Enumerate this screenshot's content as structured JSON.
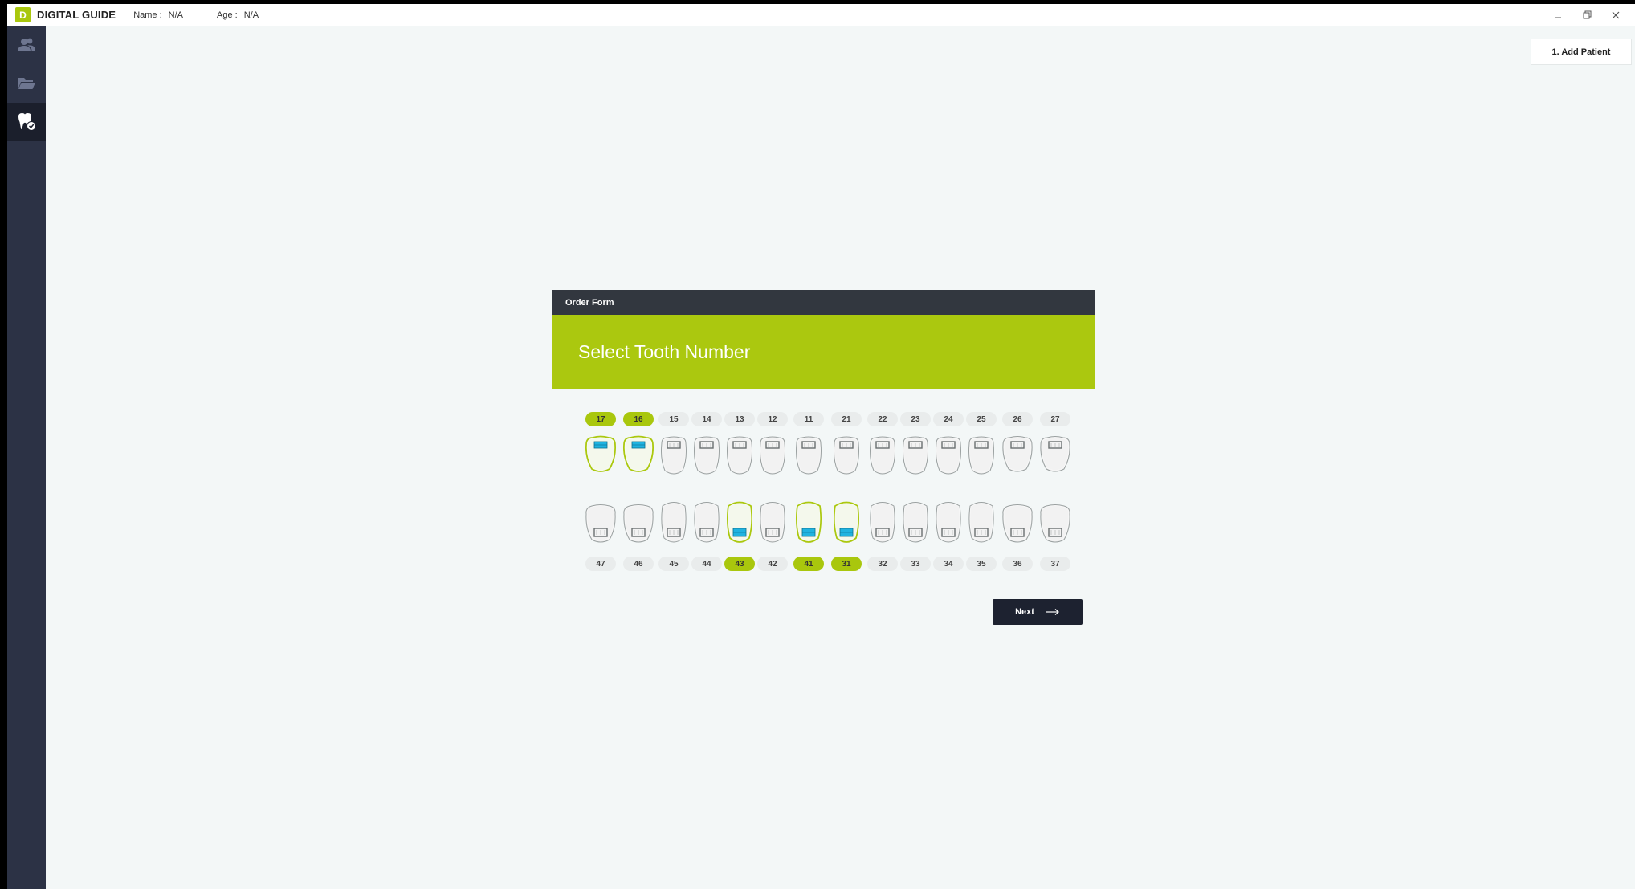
{
  "app": {
    "logo_letter": "D",
    "title": "DIGITAL GUIDE",
    "name_label": "Name :",
    "name_value": "N/A",
    "age_label": "Age :",
    "age_value": "N/A"
  },
  "window_controls": [
    "minimize-icon",
    "restore-icon",
    "close-icon"
  ],
  "sidebar": {
    "items": [
      {
        "icon": "patients-icon",
        "active": false
      },
      {
        "icon": "folder-icon",
        "active": false
      },
      {
        "icon": "tooth-check-icon",
        "active": true
      }
    ]
  },
  "step_button": {
    "label": "1. Add Patient"
  },
  "order_form": {
    "header": "Order Form",
    "title": "Select Tooth Number",
    "next_label": "Next"
  },
  "upper_teeth": [
    {
      "number": "17",
      "selected": true
    },
    {
      "number": "16",
      "selected": true
    },
    {
      "number": "15",
      "selected": false
    },
    {
      "number": "14",
      "selected": false
    },
    {
      "number": "13",
      "selected": false
    },
    {
      "number": "12",
      "selected": false
    },
    {
      "number": "11",
      "selected": false
    },
    {
      "number": "21",
      "selected": false
    },
    {
      "number": "22",
      "selected": false
    },
    {
      "number": "23",
      "selected": false
    },
    {
      "number": "24",
      "selected": false
    },
    {
      "number": "25",
      "selected": false
    },
    {
      "number": "26",
      "selected": false
    },
    {
      "number": "27",
      "selected": false
    }
  ],
  "lower_teeth": [
    {
      "number": "47",
      "selected": false
    },
    {
      "number": "46",
      "selected": false
    },
    {
      "number": "45",
      "selected": false
    },
    {
      "number": "44",
      "selected": false
    },
    {
      "number": "43",
      "selected": true
    },
    {
      "number": "42",
      "selected": false
    },
    {
      "number": "41",
      "selected": true
    },
    {
      "number": "31",
      "selected": true
    },
    {
      "number": "32",
      "selected": false
    },
    {
      "number": "33",
      "selected": false
    },
    {
      "number": "34",
      "selected": false
    },
    {
      "number": "35",
      "selected": false
    },
    {
      "number": "36",
      "selected": false
    },
    {
      "number": "37",
      "selected": false
    }
  ],
  "colors": {
    "accent": "#abc80f",
    "sidebar": "#2c3245",
    "header": "#32373f",
    "implant_blue": "#1fb3e0"
  }
}
